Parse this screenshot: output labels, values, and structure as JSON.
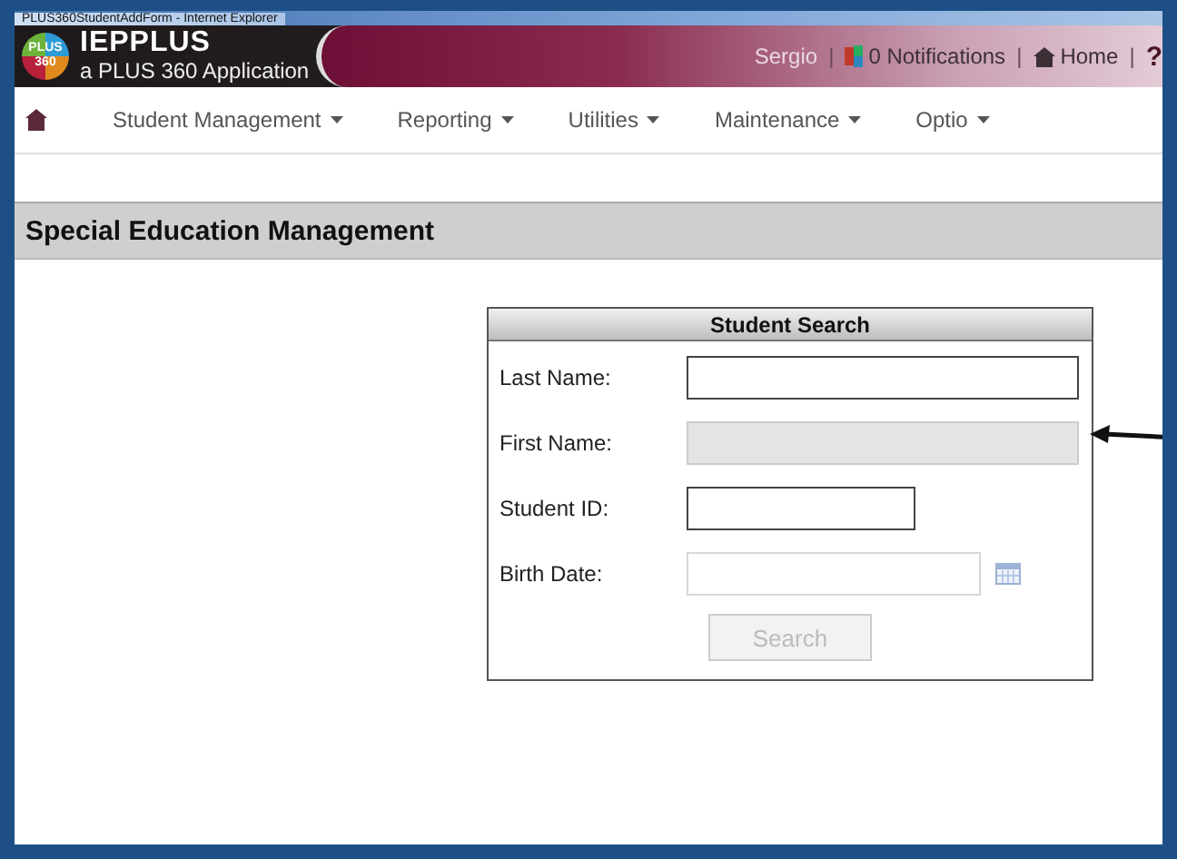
{
  "window": {
    "title": "PLUS360StudentAddForm - Internet Explorer"
  },
  "header": {
    "logo": "PLUS 360",
    "app_name": "IEPPLUS",
    "subtitle": "a PLUS 360 Application",
    "links": [
      {
        "kind": "user",
        "label": "Sergio"
      },
      {
        "kind": "separator",
        "label": "|"
      },
      {
        "kind": "notifications",
        "label": "0 Notifications"
      },
      {
        "kind": "separator",
        "label": "|"
      },
      {
        "kind": "home",
        "label": "Home"
      },
      {
        "kind": "separator",
        "label": "|"
      },
      {
        "kind": "help",
        "label": "?"
      }
    ]
  },
  "nav": {
    "items": [
      {
        "label": "Student Management"
      },
      {
        "label": "Reporting"
      },
      {
        "label": "Utilities"
      },
      {
        "label": "Maintenance"
      },
      {
        "label": "Optio"
      }
    ]
  },
  "section": {
    "title": "Special Education Management"
  },
  "search_panel": {
    "title": "Student Search",
    "fields": [
      {
        "label": "Last Name:",
        "kind": "wide",
        "disabled": false
      },
      {
        "label": "First Name:",
        "kind": "wide",
        "disabled": true
      },
      {
        "label": "Student ID:",
        "kind": "narrow",
        "disabled": false
      },
      {
        "label": "Birth Date:",
        "kind": "date",
        "disabled": true
      }
    ],
    "button": {
      "label": "Search",
      "disabled": true
    }
  }
}
